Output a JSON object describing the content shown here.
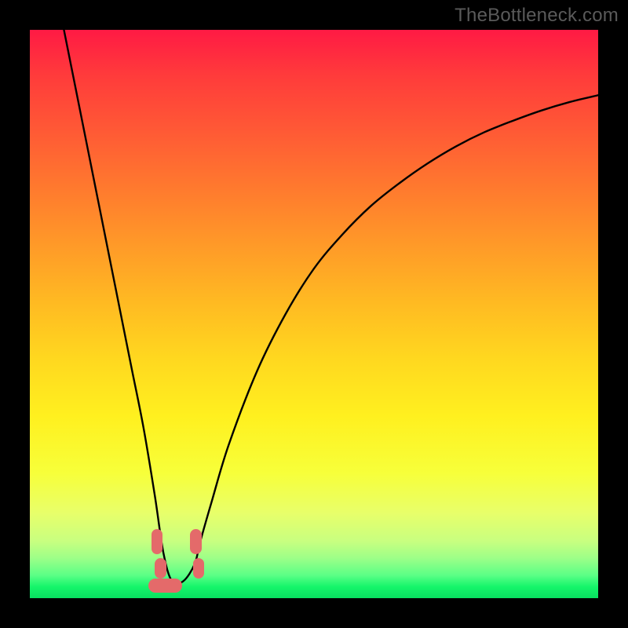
{
  "watermark": "TheBottleneck.com",
  "chart_data": {
    "type": "line",
    "title": "",
    "xlabel": "",
    "ylabel": "",
    "xlim": [
      0,
      100
    ],
    "ylim": [
      0,
      100
    ],
    "series": [
      {
        "name": "bottleneck-curve",
        "x": [
          6,
          8,
          10,
          12,
          14,
          16,
          18,
          20,
          22,
          23.5,
          25,
          27,
          29,
          30,
          32,
          35,
          40,
          45,
          50,
          55,
          60,
          65,
          70,
          75,
          80,
          85,
          90,
          95,
          100
        ],
        "values": [
          100,
          90,
          80,
          70,
          60,
          50,
          40,
          30,
          18,
          8,
          3,
          3,
          6,
          10,
          17,
          27,
          40,
          50,
          58,
          64,
          69,
          73,
          76.5,
          79.5,
          82,
          84,
          85.8,
          87.3,
          88.5
        ]
      }
    ],
    "markers": [
      {
        "name": "marker-left-top",
        "x": 22.4,
        "y": 10.0,
        "w": 2.0,
        "h": 4.4
      },
      {
        "name": "marker-left-bottom",
        "x": 23.0,
        "y": 5.2,
        "w": 2.0,
        "h": 3.6
      },
      {
        "name": "marker-right-top",
        "x": 29.2,
        "y": 10.0,
        "w": 2.0,
        "h": 4.4
      },
      {
        "name": "marker-right-bottom",
        "x": 29.7,
        "y": 5.2,
        "w": 2.0,
        "h": 3.6
      },
      {
        "name": "marker-base",
        "x": 23.8,
        "y": 2.2,
        "w": 6.0,
        "h": 2.6
      }
    ],
    "gradient_stops": [
      {
        "pos": 0,
        "color": "#ff1a44"
      },
      {
        "pos": 50,
        "color": "#ffd81f"
      },
      {
        "pos": 100,
        "color": "#08e060"
      }
    ]
  }
}
